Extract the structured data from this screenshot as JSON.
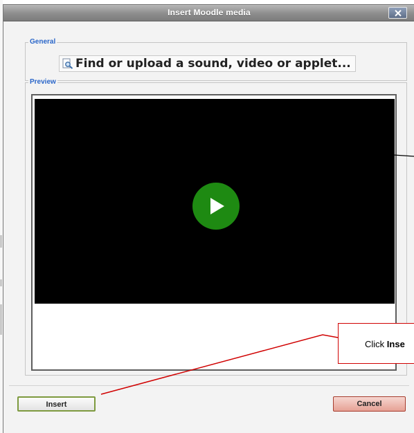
{
  "dialog": {
    "title": "Insert Moodle media",
    "close_label": "x"
  },
  "general": {
    "legend": "General",
    "find_link_label": "Find or upload a sound, video or applet..."
  },
  "preview": {
    "legend": "Preview"
  },
  "buttons": {
    "insert_label": "Insert",
    "cancel_label": "Cancel"
  },
  "callout": {
    "prefix": "Click ",
    "bold_text": "Inse"
  },
  "colors": {
    "legend_blue": "#2a66c9",
    "play_green": "#1e8a12",
    "callout_red": "#d00000"
  }
}
